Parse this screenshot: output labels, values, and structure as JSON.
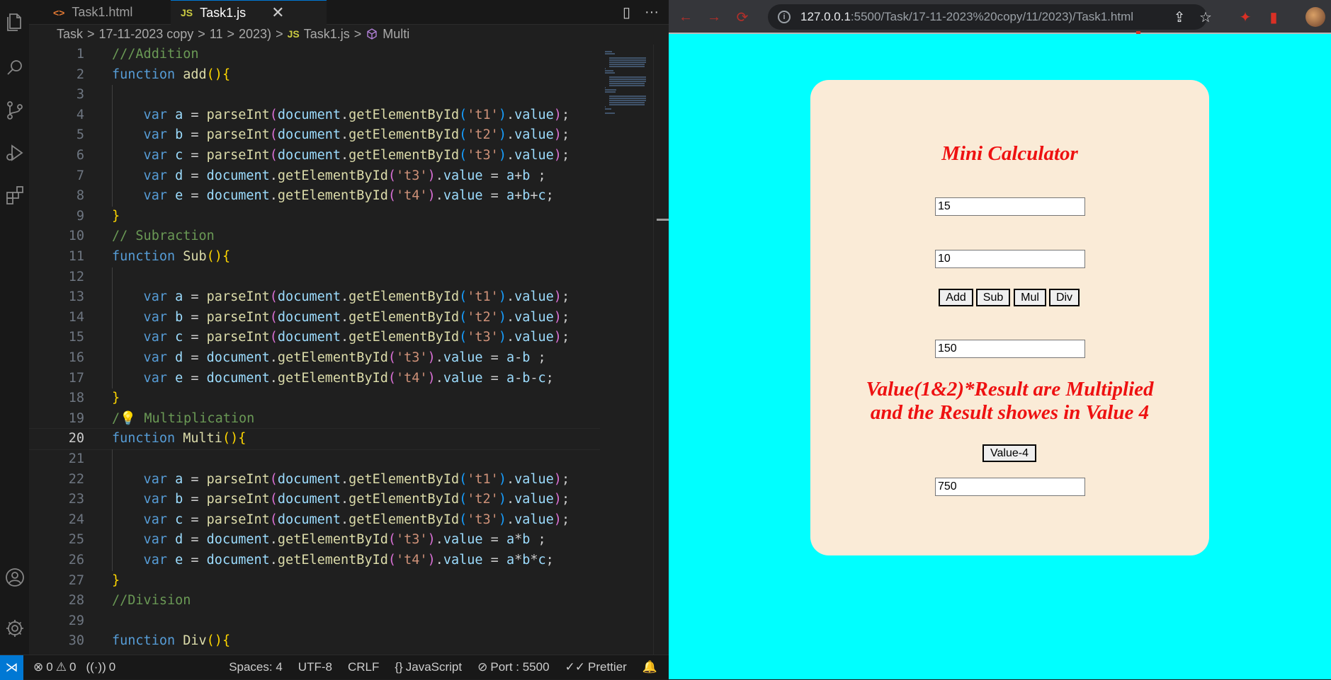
{
  "vscode": {
    "tabs": [
      {
        "icon": "<>",
        "label": "Task1.html"
      },
      {
        "icon": "JS",
        "label": "Task1.js"
      }
    ],
    "close_glyph": "✕",
    "split_glyph": "▯",
    "more_glyph": "···",
    "breadcrumb": {
      "segments": [
        "Task",
        "17-11-2023 copy",
        "11",
        "2023)"
      ],
      "separator": ">",
      "file_icon": "JS",
      "file": "Task1.js",
      "symbol": "Multi"
    },
    "current_line": 20,
    "status": {
      "errors": "0",
      "warnings": "0",
      "ports": "0",
      "spaces": "Spaces: 4",
      "encoding": "UTF-8",
      "eol": "CRLF",
      "language": "JavaScript",
      "port": "Port : 5500",
      "formatter": "Prettier"
    }
  },
  "code_lines": [
    {
      "n": "1",
      "t": [
        [
          "cm",
          "///Addition"
        ]
      ]
    },
    {
      "n": "2",
      "t": [
        [
          "kw",
          "function "
        ],
        [
          "fn",
          "add"
        ],
        [
          "br1",
          "(){"
        ]
      ]
    },
    {
      "n": "3",
      "t": []
    },
    {
      "n": "4",
      "t": [
        [
          "kw",
          "    var "
        ],
        [
          "vr",
          "a"
        ],
        [
          "p",
          " = "
        ],
        [
          "fn",
          "parseInt"
        ],
        [
          "br2",
          "("
        ],
        [
          "vr",
          "document"
        ],
        [
          "p",
          "."
        ],
        [
          "fn",
          "getElementById"
        ],
        [
          "br3",
          "("
        ],
        [
          "st",
          "'t1'"
        ],
        [
          "br3",
          ")"
        ],
        [
          "p",
          "."
        ],
        [
          "vr",
          "value"
        ],
        [
          "br2",
          ")"
        ],
        [
          "p",
          ";"
        ]
      ]
    },
    {
      "n": "5",
      "t": [
        [
          "kw",
          "    var "
        ],
        [
          "vr",
          "b"
        ],
        [
          "p",
          " = "
        ],
        [
          "fn",
          "parseInt"
        ],
        [
          "br2",
          "("
        ],
        [
          "vr",
          "document"
        ],
        [
          "p",
          "."
        ],
        [
          "fn",
          "getElementById"
        ],
        [
          "br3",
          "("
        ],
        [
          "st",
          "'t2'"
        ],
        [
          "br3",
          ")"
        ],
        [
          "p",
          "."
        ],
        [
          "vr",
          "value"
        ],
        [
          "br2",
          ")"
        ],
        [
          "p",
          ";"
        ]
      ]
    },
    {
      "n": "6",
      "t": [
        [
          "kw",
          "    var "
        ],
        [
          "vr",
          "c"
        ],
        [
          "p",
          " = "
        ],
        [
          "fn",
          "parseInt"
        ],
        [
          "br2",
          "("
        ],
        [
          "vr",
          "document"
        ],
        [
          "p",
          "."
        ],
        [
          "fn",
          "getElementById"
        ],
        [
          "br3",
          "("
        ],
        [
          "st",
          "'t3'"
        ],
        [
          "br3",
          ")"
        ],
        [
          "p",
          "."
        ],
        [
          "vr",
          "value"
        ],
        [
          "br2",
          ")"
        ],
        [
          "p",
          ";"
        ]
      ]
    },
    {
      "n": "7",
      "t": [
        [
          "kw",
          "    var "
        ],
        [
          "vr",
          "d"
        ],
        [
          "p",
          " = "
        ],
        [
          "vr",
          "document"
        ],
        [
          "p",
          "."
        ],
        [
          "fn",
          "getElementById"
        ],
        [
          "br2",
          "("
        ],
        [
          "st",
          "'t3'"
        ],
        [
          "br2",
          ")"
        ],
        [
          "p",
          "."
        ],
        [
          "vr",
          "value"
        ],
        [
          "p",
          " = "
        ],
        [
          "vr",
          "a"
        ],
        [
          "p",
          "+"
        ],
        [
          "vr",
          "b"
        ],
        [
          "p",
          " ;"
        ]
      ]
    },
    {
      "n": "8",
      "t": [
        [
          "kw",
          "    var "
        ],
        [
          "vr",
          "e"
        ],
        [
          "p",
          " = "
        ],
        [
          "vr",
          "document"
        ],
        [
          "p",
          "."
        ],
        [
          "fn",
          "getElementById"
        ],
        [
          "br2",
          "("
        ],
        [
          "st",
          "'t4'"
        ],
        [
          "br2",
          ")"
        ],
        [
          "p",
          "."
        ],
        [
          "vr",
          "value"
        ],
        [
          "p",
          " = "
        ],
        [
          "vr",
          "a"
        ],
        [
          "p",
          "+"
        ],
        [
          "vr",
          "b"
        ],
        [
          "p",
          "+"
        ],
        [
          "vr",
          "c"
        ],
        [
          "p",
          ";"
        ]
      ]
    },
    {
      "n": "9",
      "t": [
        [
          "br1",
          "}"
        ]
      ]
    },
    {
      "n": "10",
      "t": [
        [
          "cm",
          "// Subraction"
        ]
      ]
    },
    {
      "n": "11",
      "t": [
        [
          "kw",
          "function "
        ],
        [
          "fn",
          "Sub"
        ],
        [
          "br1",
          "(){"
        ]
      ]
    },
    {
      "n": "12",
      "t": []
    },
    {
      "n": "13",
      "t": [
        [
          "kw",
          "    var "
        ],
        [
          "vr",
          "a"
        ],
        [
          "p",
          " = "
        ],
        [
          "fn",
          "parseInt"
        ],
        [
          "br2",
          "("
        ],
        [
          "vr",
          "document"
        ],
        [
          "p",
          "."
        ],
        [
          "fn",
          "getElementById"
        ],
        [
          "br3",
          "("
        ],
        [
          "st",
          "'t1'"
        ],
        [
          "br3",
          ")"
        ],
        [
          "p",
          "."
        ],
        [
          "vr",
          "value"
        ],
        [
          "br2",
          ")"
        ],
        [
          "p",
          ";"
        ]
      ]
    },
    {
      "n": "14",
      "t": [
        [
          "kw",
          "    var "
        ],
        [
          "vr",
          "b"
        ],
        [
          "p",
          " = "
        ],
        [
          "fn",
          "parseInt"
        ],
        [
          "br2",
          "("
        ],
        [
          "vr",
          "document"
        ],
        [
          "p",
          "."
        ],
        [
          "fn",
          "getElementById"
        ],
        [
          "br3",
          "("
        ],
        [
          "st",
          "'t2'"
        ],
        [
          "br3",
          ")"
        ],
        [
          "p",
          "."
        ],
        [
          "vr",
          "value"
        ],
        [
          "br2",
          ")"
        ],
        [
          "p",
          ";"
        ]
      ]
    },
    {
      "n": "15",
      "t": [
        [
          "kw",
          "    var "
        ],
        [
          "vr",
          "c"
        ],
        [
          "p",
          " = "
        ],
        [
          "fn",
          "parseInt"
        ],
        [
          "br2",
          "("
        ],
        [
          "vr",
          "document"
        ],
        [
          "p",
          "."
        ],
        [
          "fn",
          "getElementById"
        ],
        [
          "br3",
          "("
        ],
        [
          "st",
          "'t3'"
        ],
        [
          "br3",
          ")"
        ],
        [
          "p",
          "."
        ],
        [
          "vr",
          "value"
        ],
        [
          "br2",
          ")"
        ],
        [
          "p",
          ";"
        ]
      ]
    },
    {
      "n": "16",
      "t": [
        [
          "kw",
          "    var "
        ],
        [
          "vr",
          "d"
        ],
        [
          "p",
          " = "
        ],
        [
          "vr",
          "document"
        ],
        [
          "p",
          "."
        ],
        [
          "fn",
          "getElementById"
        ],
        [
          "br2",
          "("
        ],
        [
          "st",
          "'t3'"
        ],
        [
          "br2",
          ")"
        ],
        [
          "p",
          "."
        ],
        [
          "vr",
          "value"
        ],
        [
          "p",
          " = "
        ],
        [
          "vr",
          "a"
        ],
        [
          "p",
          "-"
        ],
        [
          "vr",
          "b"
        ],
        [
          "p",
          " ;"
        ]
      ]
    },
    {
      "n": "17",
      "t": [
        [
          "kw",
          "    var "
        ],
        [
          "vr",
          "e"
        ],
        [
          "p",
          " = "
        ],
        [
          "vr",
          "document"
        ],
        [
          "p",
          "."
        ],
        [
          "fn",
          "getElementById"
        ],
        [
          "br2",
          "("
        ],
        [
          "st",
          "'t4'"
        ],
        [
          "br2",
          ")"
        ],
        [
          "p",
          "."
        ],
        [
          "vr",
          "value"
        ],
        [
          "p",
          " = "
        ],
        [
          "vr",
          "a"
        ],
        [
          "p",
          "-"
        ],
        [
          "vr",
          "b"
        ],
        [
          "p",
          "-"
        ],
        [
          "vr",
          "c"
        ],
        [
          "p",
          ";"
        ]
      ]
    },
    {
      "n": "18",
      "t": [
        [
          "br1",
          "}"
        ]
      ]
    },
    {
      "n": "19",
      "t": [
        [
          "cm",
          "/"
        ],
        [
          "bulb",
          "💡"
        ],
        [
          "cm",
          " Multiplication"
        ]
      ]
    },
    {
      "n": "20",
      "t": [
        [
          "kw",
          "function "
        ],
        [
          "fn",
          "Multi"
        ],
        [
          "br1",
          "(){"
        ]
      ]
    },
    {
      "n": "21",
      "t": []
    },
    {
      "n": "22",
      "t": [
        [
          "kw",
          "    var "
        ],
        [
          "vr",
          "a"
        ],
        [
          "p",
          " = "
        ],
        [
          "fn",
          "parseInt"
        ],
        [
          "br2",
          "("
        ],
        [
          "vr",
          "document"
        ],
        [
          "p",
          "."
        ],
        [
          "fn",
          "getElementById"
        ],
        [
          "br3",
          "("
        ],
        [
          "st",
          "'t1'"
        ],
        [
          "br3",
          ")"
        ],
        [
          "p",
          "."
        ],
        [
          "vr",
          "value"
        ],
        [
          "br2",
          ")"
        ],
        [
          "p",
          ";"
        ]
      ]
    },
    {
      "n": "23",
      "t": [
        [
          "kw",
          "    var "
        ],
        [
          "vr",
          "b"
        ],
        [
          "p",
          " = "
        ],
        [
          "fn",
          "parseInt"
        ],
        [
          "br2",
          "("
        ],
        [
          "vr",
          "document"
        ],
        [
          "p",
          "."
        ],
        [
          "fn",
          "getElementById"
        ],
        [
          "br3",
          "("
        ],
        [
          "st",
          "'t2'"
        ],
        [
          "br3",
          ")"
        ],
        [
          "p",
          "."
        ],
        [
          "vr",
          "value"
        ],
        [
          "br2",
          ")"
        ],
        [
          "p",
          ";"
        ]
      ]
    },
    {
      "n": "24",
      "t": [
        [
          "kw",
          "    var "
        ],
        [
          "vr",
          "c"
        ],
        [
          "p",
          " = "
        ],
        [
          "fn",
          "parseInt"
        ],
        [
          "br2",
          "("
        ],
        [
          "vr",
          "document"
        ],
        [
          "p",
          "."
        ],
        [
          "fn",
          "getElementById"
        ],
        [
          "br3",
          "("
        ],
        [
          "st",
          "'t3'"
        ],
        [
          "br3",
          ")"
        ],
        [
          "p",
          "."
        ],
        [
          "vr",
          "value"
        ],
        [
          "br2",
          ")"
        ],
        [
          "p",
          ";"
        ]
      ]
    },
    {
      "n": "25",
      "t": [
        [
          "kw",
          "    var "
        ],
        [
          "vr",
          "d"
        ],
        [
          "p",
          " = "
        ],
        [
          "vr",
          "document"
        ],
        [
          "p",
          "."
        ],
        [
          "fn",
          "getElementById"
        ],
        [
          "br2",
          "("
        ],
        [
          "st",
          "'t3'"
        ],
        [
          "br2",
          ")"
        ],
        [
          "p",
          "."
        ],
        [
          "vr",
          "value"
        ],
        [
          "p",
          " = "
        ],
        [
          "vr",
          "a"
        ],
        [
          "p",
          "*"
        ],
        [
          "vr",
          "b"
        ],
        [
          "p",
          " ;"
        ]
      ]
    },
    {
      "n": "26",
      "t": [
        [
          "kw",
          "    var "
        ],
        [
          "vr",
          "e"
        ],
        [
          "p",
          " = "
        ],
        [
          "vr",
          "document"
        ],
        [
          "p",
          "."
        ],
        [
          "fn",
          "getElementById"
        ],
        [
          "br2",
          "("
        ],
        [
          "st",
          "'t4'"
        ],
        [
          "br2",
          ")"
        ],
        [
          "p",
          "."
        ],
        [
          "vr",
          "value"
        ],
        [
          "p",
          " = "
        ],
        [
          "vr",
          "a"
        ],
        [
          "p",
          "*"
        ],
        [
          "vr",
          "b"
        ],
        [
          "p",
          "*"
        ],
        [
          "vr",
          "c"
        ],
        [
          "p",
          ";"
        ]
      ]
    },
    {
      "n": "27",
      "t": [
        [
          "br1",
          "}"
        ]
      ]
    },
    {
      "n": "28",
      "t": [
        [
          "cm",
          "//Division"
        ]
      ]
    },
    {
      "n": "29",
      "t": []
    },
    {
      "n": "30",
      "t": [
        [
          "kw",
          "function "
        ],
        [
          "fn",
          "Div"
        ],
        [
          "br1",
          "(){"
        ]
      ]
    }
  ],
  "browser": {
    "url_host": "127.0.0.1",
    "url_path": ":5500/Task/17-11-2023%20copy/11/2023)/Task1.html",
    "back_glyph": "←",
    "forward_glyph": "→",
    "reload_glyph": "⟳",
    "info_glyph": "i",
    "share_glyph": "⇪",
    "star_glyph": "☆",
    "extensions_glyph": "✦",
    "sidepanel_glyph": "▮"
  },
  "calculator": {
    "title": "Mini Calculator",
    "value1": "15",
    "value2": "10",
    "buttons": [
      "Add",
      "Sub",
      "Mul",
      "Div"
    ],
    "result": "150",
    "message_line1": "Value(1&2)*Result are Multiplied",
    "message_line2": "and the Result showes in Value 4",
    "value4_button": "Value-4",
    "value4": "750"
  },
  "colors": {
    "page_bg": "#00ffff",
    "card_bg": "#faebd7",
    "heading": "#ee1111",
    "vscode_accent": "#0078d4"
  }
}
